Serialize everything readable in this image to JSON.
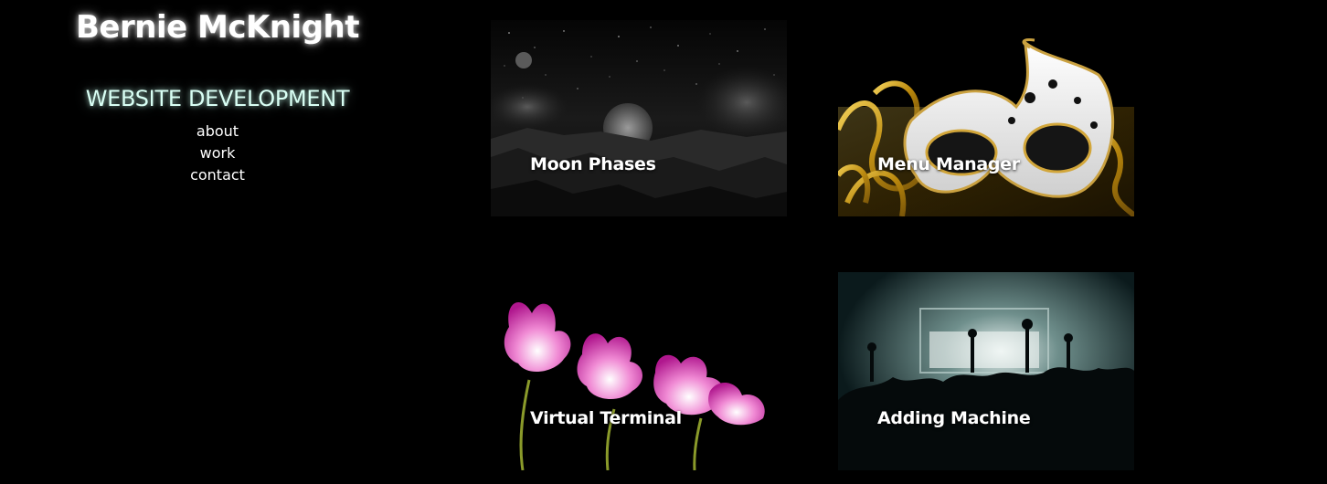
{
  "header": {
    "title": "Bernie McKnight",
    "subtitle": "WEBSITE DEVELOPMENT"
  },
  "nav": {
    "items": [
      {
        "label": "about"
      },
      {
        "label": "work"
      },
      {
        "label": "contact"
      }
    ]
  },
  "projects": [
    {
      "label": "Moon Phases",
      "image": "moon-landscape-image"
    },
    {
      "label": "Menu Manager",
      "image": "masquerade-mask-image"
    },
    {
      "label": "Virtual Terminal",
      "image": "pink-flowers-image"
    },
    {
      "label": "Adding Machine",
      "image": "concert-crowd-image"
    }
  ]
}
